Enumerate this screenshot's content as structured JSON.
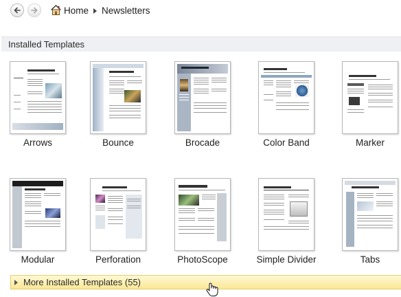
{
  "nav": {
    "home_label": "Home",
    "current_label": "Newsletters"
  },
  "section": {
    "title": "Installed Templates"
  },
  "templates": [
    {
      "label": "Arrows"
    },
    {
      "label": "Bounce"
    },
    {
      "label": "Brocade"
    },
    {
      "label": "Color Band"
    },
    {
      "label": "Marker"
    },
    {
      "label": "Modular"
    },
    {
      "label": "Perforation"
    },
    {
      "label": "PhotoScope"
    },
    {
      "label": "Simple Divider"
    },
    {
      "label": "Tabs"
    }
  ],
  "more": {
    "label": "More Installed Templates (55)"
  },
  "icons": {
    "back": "back-arrow-icon",
    "forward": "forward-arrow-icon",
    "home": "home-icon",
    "expand": "triangle-right-icon",
    "cursor": "hand-pointer-icon"
  },
  "colors": {
    "section_bg": "#eef0f4",
    "more_bar_bg": "#fbe795",
    "more_bar_border": "#e3cf6a"
  }
}
